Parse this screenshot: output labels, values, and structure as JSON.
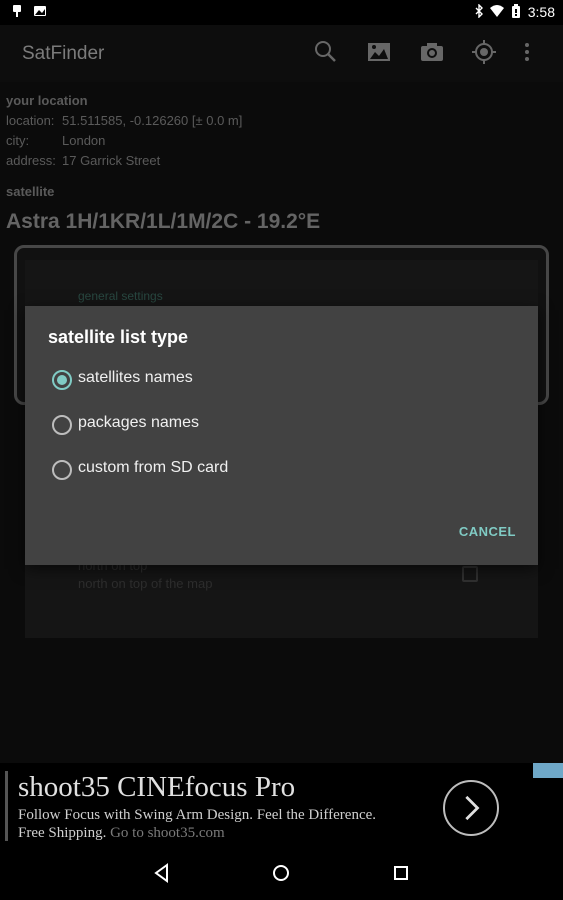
{
  "status_bar": {
    "time": "3:58",
    "icons": [
      "notification-icon",
      "photo-notification-icon",
      "bluetooth-icon",
      "wifi-icon",
      "battery-icon"
    ]
  },
  "app_bar": {
    "title": "SatFinder",
    "actions": [
      "search-icon",
      "map-icon",
      "camera-icon",
      "gps-locate-icon",
      "overflow-menu-icon"
    ]
  },
  "location": {
    "heading": "your location",
    "rows": [
      {
        "label": "location:",
        "value": "51.511585, -0.126260 [± 0.0 m]"
      },
      {
        "label": "city:",
        "value": "London"
      },
      {
        "label": "address:",
        "value": "17 Garrick Street"
      }
    ]
  },
  "satellite": {
    "heading": "satellite",
    "name": "Astra 1H/1KR/1L/1M/2C - 19.2°E"
  },
  "settings": {
    "general_label": "general settings",
    "north_title": "north on top",
    "north_subtitle": "north on top of the map",
    "north_checked": false
  },
  "dialog": {
    "title": "satellite list type",
    "options": [
      {
        "label": "satellites names",
        "selected": true
      },
      {
        "label": "packages names",
        "selected": false
      },
      {
        "label": "custom from SD card",
        "selected": false
      }
    ],
    "cancel": "CANCEL"
  },
  "ad": {
    "title": "shoot35 CINEfocus Pro",
    "line1": "Follow Focus with Swing Arm Design. Feel the Difference.",
    "line2": "Free Shipping.",
    "line2_link": "Go to shoot35.com"
  },
  "nav": [
    "back-icon",
    "home-icon",
    "recents-icon"
  ],
  "colors": {
    "accent": "#80cbc4",
    "dialog_bg": "#424242",
    "app_bar": "#141414"
  }
}
